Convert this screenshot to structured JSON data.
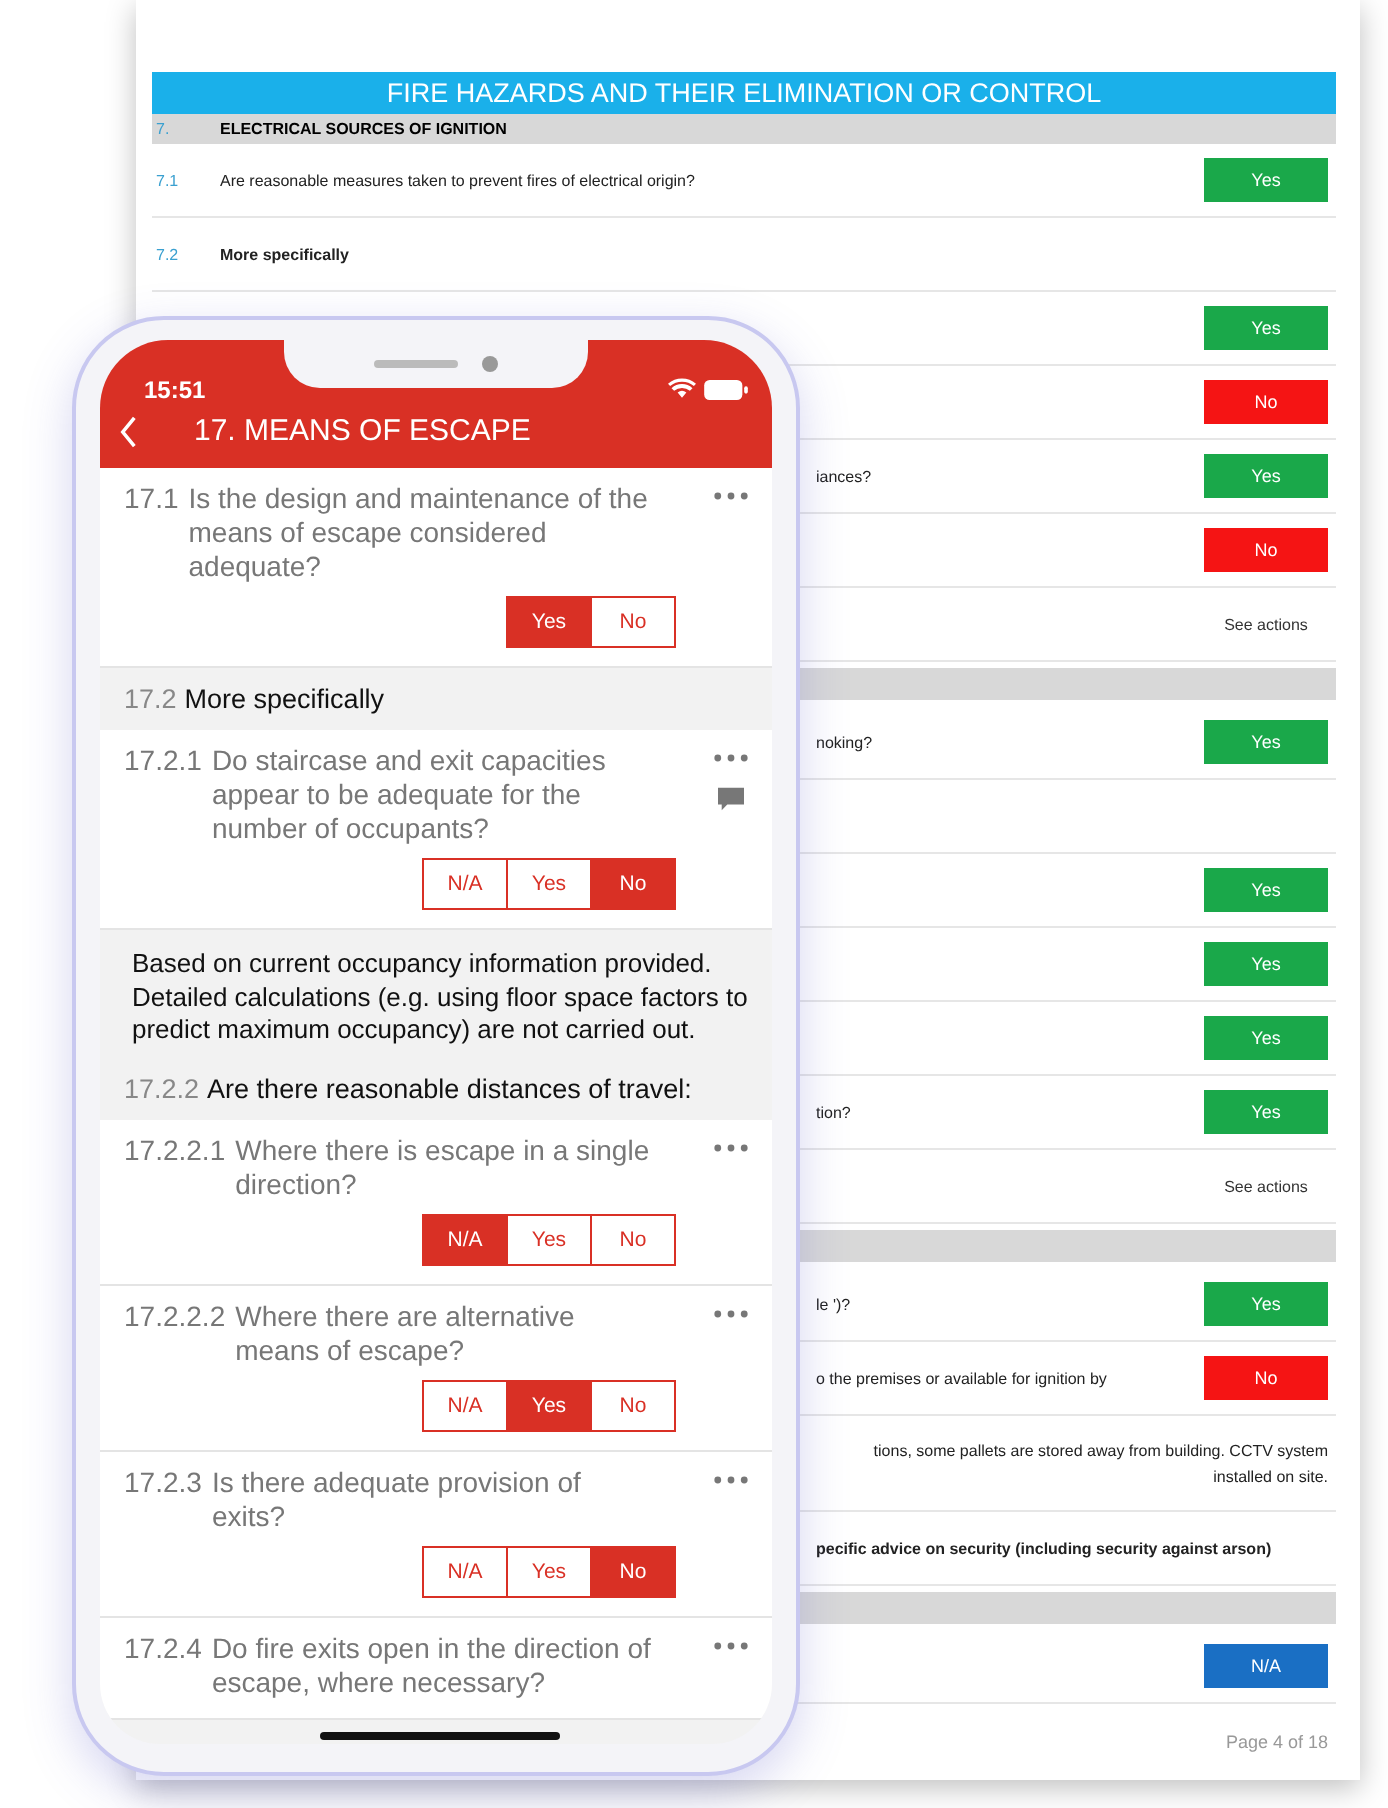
{
  "document": {
    "title": "FIRE HAZARDS AND THEIR ELIMINATION OR CONTROL",
    "section": {
      "number": "7.",
      "label": "ELECTRICAL SOURCES OF IGNITION"
    },
    "rows": [
      {
        "kind": "full",
        "number": "7.1",
        "text": "Are reasonable measures taken to prevent fires of electrical origin?",
        "answer": {
          "kind": "yes",
          "label": "Yes"
        }
      },
      {
        "kind": "full",
        "number": "7.2",
        "text": "More specifically",
        "bold": true
      },
      {
        "kind": "partial",
        "answer": {
          "kind": "yes",
          "label": "Yes"
        }
      },
      {
        "kind": "partial",
        "answer": {
          "kind": "no",
          "label": "No"
        }
      },
      {
        "kind": "partial",
        "text": "iances?",
        "answer": {
          "kind": "yes",
          "label": "Yes"
        }
      },
      {
        "kind": "partial",
        "answer": {
          "kind": "no",
          "label": "No"
        }
      },
      {
        "kind": "partial",
        "answer": {
          "kind": "link",
          "label": "See actions"
        }
      },
      {
        "kind": "bar"
      },
      {
        "kind": "partial",
        "text": "noking?",
        "answer": {
          "kind": "yes",
          "label": "Yes"
        }
      },
      {
        "kind": "partial"
      },
      {
        "kind": "partial",
        "answer": {
          "kind": "yes",
          "label": "Yes"
        }
      },
      {
        "kind": "partial",
        "answer": {
          "kind": "yes",
          "label": "Yes"
        }
      },
      {
        "kind": "partial",
        "answer": {
          "kind": "yes",
          "label": "Yes"
        }
      },
      {
        "kind": "partial",
        "text": "tion?",
        "answer": {
          "kind": "yes",
          "label": "Yes"
        }
      },
      {
        "kind": "partial",
        "answer": {
          "kind": "link",
          "label": "See actions"
        }
      },
      {
        "kind": "bar"
      },
      {
        "kind": "partial",
        "text": "le ')?",
        "answer": {
          "kind": "yes",
          "label": "Yes"
        }
      },
      {
        "kind": "partial",
        "text": "o the premises or available for ignition by",
        "answer": {
          "kind": "no",
          "label": "No"
        }
      },
      {
        "kind": "note",
        "text": "tions, some pallets are stored away from building. CCTV system installed on site."
      },
      {
        "kind": "partial",
        "text": "pecific advice on security (including security against arson)",
        "bold": true
      },
      {
        "kind": "bar"
      },
      {
        "kind": "partial",
        "answer": {
          "kind": "na",
          "label": "N/A"
        }
      }
    ],
    "footer": "Page 4 of 18"
  },
  "phone": {
    "time": "15:51",
    "title": "17. MEANS OF ESCAPE",
    "items": [
      {
        "kind": "question",
        "number": "17.1",
        "text": "Is the design and maintenance of the means of escape considered adequate?",
        "has_comment": false,
        "options": [
          {
            "label": "Yes",
            "selected": true
          },
          {
            "label": "No",
            "selected": false
          }
        ]
      },
      {
        "kind": "section",
        "number": "17.2",
        "text": "More specifically"
      },
      {
        "kind": "question",
        "number": "17.2.1",
        "text": "Do staircase and exit capacities appear to be adequate for the number of occupants?",
        "has_comment": true,
        "options": [
          {
            "label": "N/A",
            "selected": false
          },
          {
            "label": "Yes",
            "selected": false
          },
          {
            "label": "No",
            "selected": true
          }
        ]
      },
      {
        "kind": "note",
        "text": "Based on current occupancy information provided. Detailed calculations (e.g. using floor space factors to predict maximum occupancy) are not carried out."
      },
      {
        "kind": "section",
        "number": "17.2.2",
        "text": "Are there reasonable distances of travel:"
      },
      {
        "kind": "question",
        "number": "17.2.2.1",
        "text": "Where there is escape in a single direction?",
        "has_comment": false,
        "options": [
          {
            "label": "N/A",
            "selected": true
          },
          {
            "label": "Yes",
            "selected": false
          },
          {
            "label": "No",
            "selected": false
          }
        ]
      },
      {
        "kind": "question",
        "number": "17.2.2.2",
        "text": "Where there are alternative means of escape?",
        "has_comment": false,
        "options": [
          {
            "label": "N/A",
            "selected": false
          },
          {
            "label": "Yes",
            "selected": true
          },
          {
            "label": "No",
            "selected": false
          }
        ]
      },
      {
        "kind": "question",
        "number": "17.2.3",
        "text": "Is there adequate provision of exits?",
        "has_comment": false,
        "options": [
          {
            "label": "N/A",
            "selected": false
          },
          {
            "label": "Yes",
            "selected": false
          },
          {
            "label": "No",
            "selected": true
          }
        ]
      },
      {
        "kind": "question",
        "number": "17.2.4",
        "text": "Do fire exits open in the direction of escape, where necessary?",
        "has_comment": false
      }
    ]
  }
}
